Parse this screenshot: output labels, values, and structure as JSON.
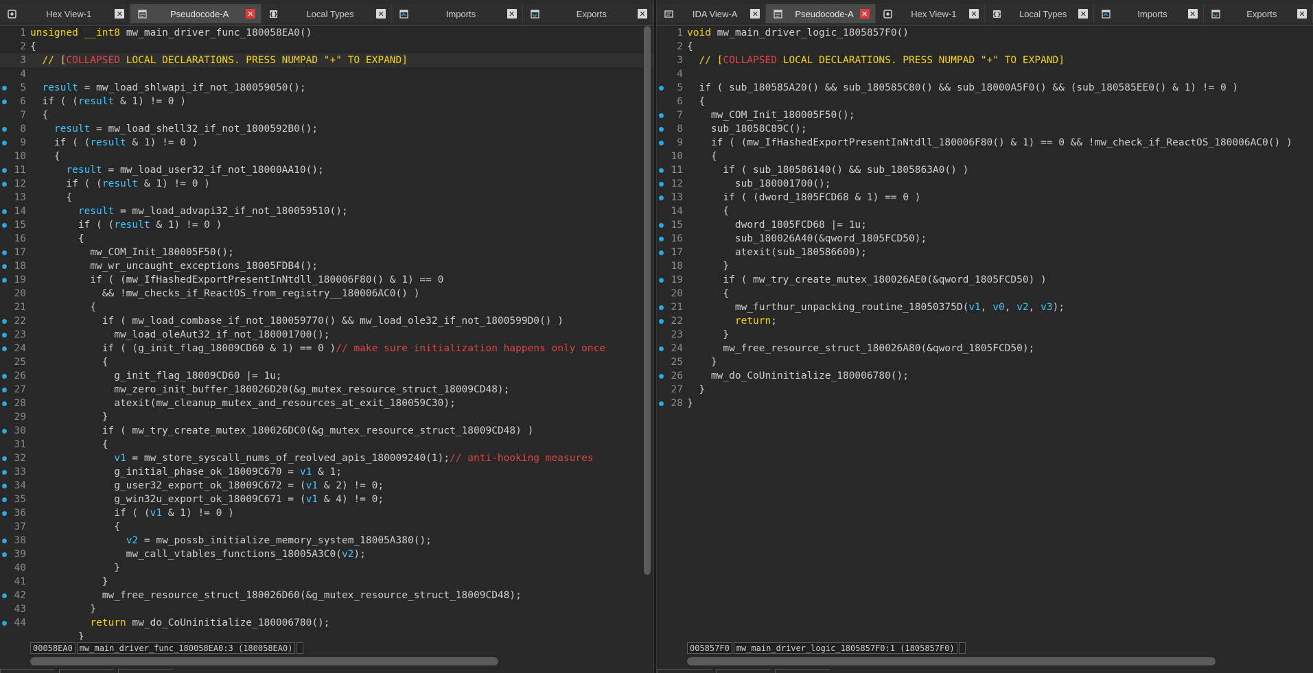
{
  "accent": "#27a9e1",
  "left_pane": {
    "tabs": [
      {
        "label": "Hex View-1",
        "icon": "hex-view-icon",
        "active": false
      },
      {
        "label": "Pseudocode-A",
        "icon": "pseudocode-icon",
        "active": true
      },
      {
        "label": "Local Types",
        "icon": "local-types-icon",
        "active": false
      },
      {
        "label": "Imports",
        "icon": "imports-icon",
        "active": false
      },
      {
        "label": "Exports",
        "icon": "exports-icon",
        "active": false
      }
    ],
    "lines": [
      {
        "n": "1",
        "dot": false,
        "text": "unsigned __int8 mw_main_driver_func_180058EA0()"
      },
      {
        "n": "2",
        "dot": false,
        "text": "{"
      },
      {
        "n": "3",
        "dot": false,
        "text": "  // [COLLAPSED LOCAL DECLARATIONS. PRESS NUMPAD \"+\" TO EXPAND]",
        "highlight": true
      },
      {
        "n": "4",
        "dot": false,
        "text": ""
      },
      {
        "n": "5",
        "dot": true,
        "text": "  result = mw_load_shlwapi_if_not_180059050();"
      },
      {
        "n": "6",
        "dot": true,
        "text": "  if ( (result & 1) != 0 )"
      },
      {
        "n": "7",
        "dot": false,
        "text": "  {"
      },
      {
        "n": "8",
        "dot": true,
        "text": "    result = mw_load_shell32_if_not_1800592B0();"
      },
      {
        "n": "9",
        "dot": true,
        "text": "    if ( (result & 1) != 0 )"
      },
      {
        "n": "10",
        "dot": false,
        "text": "    {"
      },
      {
        "n": "11",
        "dot": true,
        "text": "      result = mw_load_user32_if_not_18000AA10();"
      },
      {
        "n": "12",
        "dot": true,
        "text": "      if ( (result & 1) != 0 )"
      },
      {
        "n": "13",
        "dot": false,
        "text": "      {"
      },
      {
        "n": "14",
        "dot": true,
        "text": "        result = mw_load_advapi32_if_not_180059510();"
      },
      {
        "n": "15",
        "dot": true,
        "text": "        if ( (result & 1) != 0 )"
      },
      {
        "n": "16",
        "dot": false,
        "text": "        {"
      },
      {
        "n": "17",
        "dot": true,
        "text": "          mw_COM_Init_180005F50();"
      },
      {
        "n": "18",
        "dot": true,
        "text": "          mw_wr_uncaught_exceptions_18005FDB4();"
      },
      {
        "n": "19",
        "dot": true,
        "text": "          if ( (mw_IfHashedExportPresentInNtdll_180006F80() & 1) == 0"
      },
      {
        "n": "20",
        "dot": false,
        "text": "            && !mw_checks_if_ReactOS_from_registry__180006AC0() )"
      },
      {
        "n": "21",
        "dot": false,
        "text": "          {"
      },
      {
        "n": "22",
        "dot": true,
        "text": "            if ( mw_load_combase_if_not_180059770() && mw_load_ole32_if_not_1800599D0() )"
      },
      {
        "n": "23",
        "dot": true,
        "text": "              mw_load_oleAut32_if_not_180001700();"
      },
      {
        "n": "24",
        "dot": true,
        "text": "            if ( (g_init_flag_18009CD60 & 1) == 0 )// make sure initialization happens only once"
      },
      {
        "n": "25",
        "dot": false,
        "text": "            {"
      },
      {
        "n": "26",
        "dot": true,
        "text": "              g_init_flag_18009CD60 |= 1u;"
      },
      {
        "n": "27",
        "dot": true,
        "text": "              mw_zero_init_buffer_180026D20(&g_mutex_resource_struct_18009CD48);"
      },
      {
        "n": "28",
        "dot": true,
        "text": "              atexit(mw_cleanup_mutex_and_resources_at_exit_180059C30);"
      },
      {
        "n": "29",
        "dot": false,
        "text": "            }"
      },
      {
        "n": "30",
        "dot": true,
        "text": "            if ( mw_try_create_mutex_180026DC0(&g_mutex_resource_struct_18009CD48) )"
      },
      {
        "n": "31",
        "dot": false,
        "text": "            {"
      },
      {
        "n": "32",
        "dot": true,
        "text": "              v1 = mw_store_syscall_nums_of_reolved_apis_180009240(1);// anti-hooking measures"
      },
      {
        "n": "33",
        "dot": true,
        "text": "              g_initial_phase_ok_18009C670 = v1 & 1;"
      },
      {
        "n": "34",
        "dot": true,
        "text": "              g_user32_export_ok_18009C672 = (v1 & 2) != 0;"
      },
      {
        "n": "35",
        "dot": true,
        "text": "              g_win32u_export_ok_18009C671 = (v1 & 4) != 0;"
      },
      {
        "n": "36",
        "dot": true,
        "text": "              if ( (v1 & 1) != 0 )"
      },
      {
        "n": "37",
        "dot": false,
        "text": "              {"
      },
      {
        "n": "38",
        "dot": true,
        "text": "                v2 = mw_possb_initialize_memory_system_18005A380();"
      },
      {
        "n": "39",
        "dot": true,
        "text": "                mw_call_vtables_functions_18005A3C0(v2);"
      },
      {
        "n": "40",
        "dot": false,
        "text": "              }"
      },
      {
        "n": "41",
        "dot": false,
        "text": "            }"
      },
      {
        "n": "42",
        "dot": true,
        "text": "            mw_free_resource_struct_180026D60(&g_mutex_resource_struct_18009CD48);"
      },
      {
        "n": "43",
        "dot": false,
        "text": "          }"
      },
      {
        "n": "44",
        "dot": true,
        "text": "          return mw_do_CoUninitialize_180006780();"
      },
      {
        "n": "",
        "dot": false,
        "text": "        }"
      }
    ],
    "status": {
      "address": "00058EA0",
      "location": "mw_main_driver_func_180058EA0:3 (180058EA0)"
    }
  },
  "right_pane": {
    "tabs": [
      {
        "label": "IDA View-A",
        "icon": "ida-view-icon",
        "active": false
      },
      {
        "label": "Pseudocode-A",
        "icon": "pseudocode-icon",
        "active": true
      },
      {
        "label": "Hex View-1",
        "icon": "hex-view-icon",
        "active": false
      },
      {
        "label": "Local Types",
        "icon": "local-types-icon",
        "active": false
      },
      {
        "label": "Imports",
        "icon": "imports-icon",
        "active": false
      },
      {
        "label": "Exports",
        "icon": "exports-icon",
        "active": false
      }
    ],
    "lines": [
      {
        "n": "1",
        "dot": false,
        "text": "void mw_main_driver_logic_1805857F0()"
      },
      {
        "n": "2",
        "dot": false,
        "text": "{"
      },
      {
        "n": "3",
        "dot": false,
        "text": "  // [COLLAPSED LOCAL DECLARATIONS. PRESS NUMPAD \"+\" TO EXPAND]"
      },
      {
        "n": "4",
        "dot": false,
        "text": ""
      },
      {
        "n": "5",
        "dot": true,
        "text": "  if ( sub_180585A20() && sub_180585C80() && sub_18000A5F0() && (sub_180585EE0() & 1) != 0 )"
      },
      {
        "n": "6",
        "dot": false,
        "text": "  {"
      },
      {
        "n": "7",
        "dot": true,
        "text": "    mw_COM_Init_180005F50();"
      },
      {
        "n": "8",
        "dot": true,
        "text": "    sub_18058C89C();"
      },
      {
        "n": "9",
        "dot": true,
        "text": "    if ( (mw_IfHashedExportPresentInNtdll_180006F80() & 1) == 0 && !mw_check_if_ReactOS_180006AC0() )"
      },
      {
        "n": "10",
        "dot": false,
        "text": "    {"
      },
      {
        "n": "11",
        "dot": true,
        "text": "      if ( sub_180586140() && sub_1805863A0() )"
      },
      {
        "n": "12",
        "dot": true,
        "text": "        sub_180001700();"
      },
      {
        "n": "13",
        "dot": true,
        "text": "      if ( (dword_1805FCD68 & 1) == 0 )"
      },
      {
        "n": "14",
        "dot": false,
        "text": "      {"
      },
      {
        "n": "15",
        "dot": true,
        "text": "        dword_1805FCD68 |= 1u;"
      },
      {
        "n": "16",
        "dot": true,
        "text": "        sub_180026A40(&qword_1805FCD50);"
      },
      {
        "n": "17",
        "dot": true,
        "text": "        atexit(sub_180586600);"
      },
      {
        "n": "18",
        "dot": false,
        "text": "      }"
      },
      {
        "n": "19",
        "dot": true,
        "text": "      if ( mw_try_create_mutex_180026AE0(&qword_1805FCD50) )"
      },
      {
        "n": "20",
        "dot": false,
        "text": "      {"
      },
      {
        "n": "21",
        "dot": true,
        "text": "        mw_furthur_unpacking_routine_18050375D(v1, v0, v2, v3);"
      },
      {
        "n": "22",
        "dot": true,
        "text": "        return;"
      },
      {
        "n": "23",
        "dot": false,
        "text": "      }"
      },
      {
        "n": "24",
        "dot": true,
        "text": "      mw_free_resource_struct_180026A80(&qword_1805FCD50);"
      },
      {
        "n": "25",
        "dot": false,
        "text": "    }"
      },
      {
        "n": "26",
        "dot": true,
        "text": "    mw_do_CoUninitialize_180006780();"
      },
      {
        "n": "27",
        "dot": false,
        "text": "  }"
      },
      {
        "n": "28",
        "dot": true,
        "text": "}"
      }
    ],
    "status": {
      "address": "005857F0",
      "location": "mw_main_driver_logic_1805857F0:1 (1805857F0)"
    }
  }
}
